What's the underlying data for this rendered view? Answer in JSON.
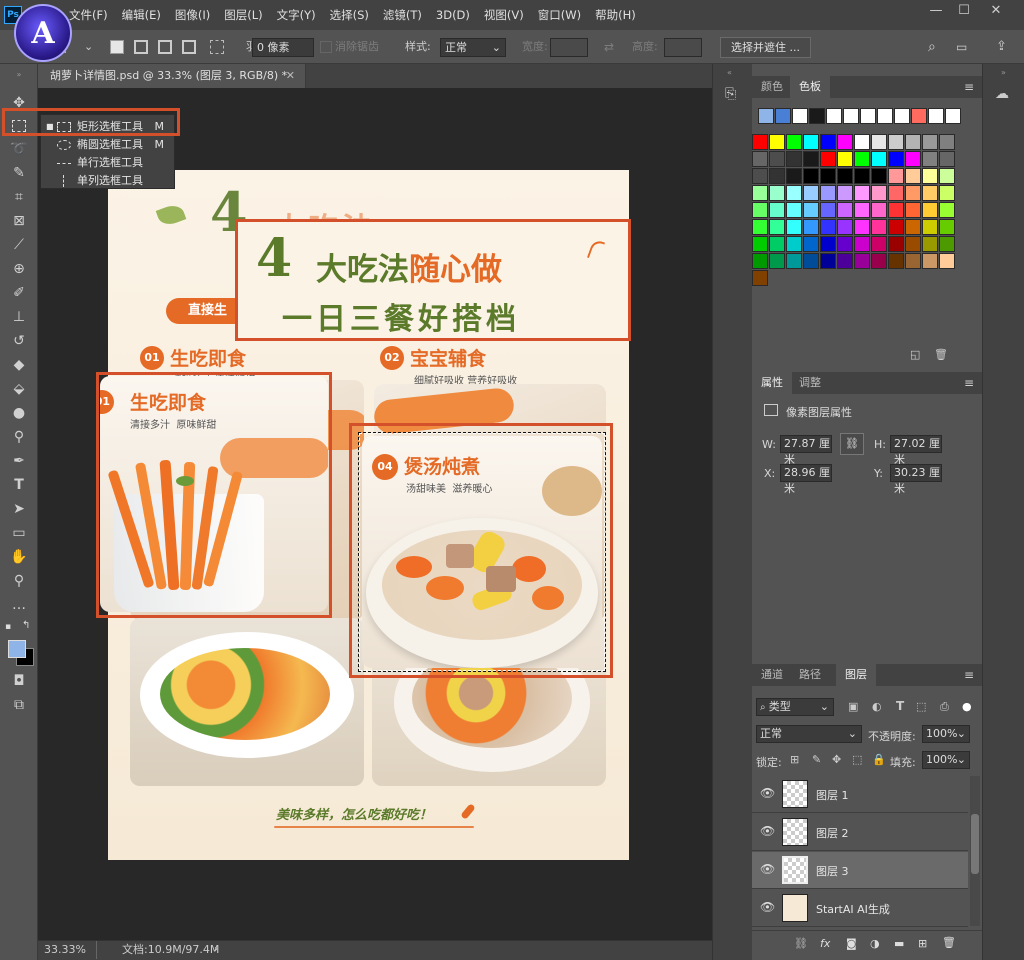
{
  "menubar": {
    "items": [
      "文件(F)",
      "编辑(E)",
      "图像(I)",
      "图层(L)",
      "文字(Y)",
      "选择(S)",
      "滤镜(T)",
      "3D(D)",
      "视图(V)",
      "窗口(W)",
      "帮助(H)"
    ],
    "app_logo_text": "Ps",
    "badge_letter": "A"
  },
  "options": {
    "feather_label": "羽化:",
    "feather_value": "0 像素",
    "antialias_label": "消除锯齿",
    "style_label": "样式:",
    "style_value": "正常",
    "width_label": "宽度:",
    "height_label": "高度:",
    "select_mask_button": "选择并遮住 ..."
  },
  "document": {
    "tab_title": "胡萝卜详情图.psd @ 33.3% (图层 3, RGB/8) *",
    "zoom": "33.33%",
    "doc_size": "文档:10.9M/97.4M"
  },
  "flyout": {
    "items": [
      {
        "label": "矩形选框工具",
        "key": "M"
      },
      {
        "label": "椭圆选框工具",
        "key": "M"
      },
      {
        "label": "单行选框工具",
        "key": ""
      },
      {
        "label": "单列选框工具",
        "key": ""
      }
    ]
  },
  "artboard": {
    "title_big_number": "4",
    "title_line1_a": "大吃法",
    "title_line1_b": "随心做",
    "title_line2": "一日三餐好搭档",
    "banner_label": "直接生",
    "sec01_num": "01",
    "sec01_title": "生吃即食",
    "sec01_sub": "清接多汁 原味鲜甜",
    "sec02_num": "02",
    "sec02_title": "宝宝辅食",
    "sec02_sub": "细腻好吸收 营养好吸收",
    "popout01_num": "01",
    "popout01_title": "生吃即食",
    "popout01_sub": "清接多汁  原味鲜甜",
    "sec04_num": "04",
    "sec04_title": "煲汤炖煮",
    "sec04_sub": "汤甜味美  滋养暖心",
    "footer_text": "美味多样，怎么吃都好吃！"
  },
  "swatches_panel": {
    "tabs": [
      "颜色",
      "色板"
    ],
    "active": "色板",
    "recent": [
      "#8fb4e8",
      "#4a7fd6",
      "#ffffff",
      "#1a1a1a",
      "#ffffff",
      "#ffffff",
      "#ffffff",
      "#ffffff",
      "#ffffff",
      "#ff6b5e",
      "#ffffff",
      "#ffffff"
    ],
    "grid": [
      [
        "#ff0000",
        "#ffff00",
        "#00ff00",
        "#00ffff",
        "#0000ff",
        "#ff00ff",
        "#ffffff",
        "#e6e6e6",
        "#cccccc",
        "#b3b3b3",
        "#999999",
        "#808080"
      ],
      [
        "#666666",
        "#4d4d4d",
        "#333333",
        "#1a1a1a",
        "#ff0000",
        "#ffff00",
        "#00ff00",
        "#00ffff",
        "#0000ff",
        "#ff00ff",
        "#808080",
        "#666666"
      ],
      [
        "#4d4d4d",
        "#333333",
        "#1a1a1a",
        "#000000",
        "#000000",
        "#000000",
        "#000000",
        "#000000",
        "#ff9999",
        "#ffcc99",
        "#ffff99",
        "#ccff99"
      ],
      [
        "#99ff99",
        "#99ffcc",
        "#99ffff",
        "#99ccff",
        "#9999ff",
        "#cc99ff",
        "#ff99ff",
        "#ff99cc",
        "#ff6666",
        "#ff9966",
        "#ffcc66",
        "#ccff66"
      ],
      [
        "#66ff66",
        "#66ffcc",
        "#66ffff",
        "#66ccff",
        "#6666ff",
        "#cc66ff",
        "#ff66ff",
        "#ff66cc",
        "#ff3333",
        "#ff6633",
        "#ffcc33",
        "#99ff33"
      ],
      [
        "#33ff33",
        "#33ff99",
        "#33ffff",
        "#3399ff",
        "#3333ff",
        "#9933ff",
        "#ff33ff",
        "#ff3399",
        "#cc0000",
        "#cc6600",
        "#cccc00",
        "#66cc00"
      ],
      [
        "#00cc00",
        "#00cc66",
        "#00cccc",
        "#0066cc",
        "#0000cc",
        "#6600cc",
        "#cc00cc",
        "#cc0066",
        "#990000",
        "#994c00",
        "#999900",
        "#4c9900"
      ],
      [
        "#009900",
        "#00994c",
        "#009999",
        "#004c99",
        "#000099",
        "#4c0099",
        "#990099",
        "#99004c",
        "#663300",
        "#996633",
        "#cc9966",
        "#ffcc99"
      ],
      [
        "#804000"
      ]
    ]
  },
  "properties_panel": {
    "tabs": [
      "属性",
      "调整"
    ],
    "active": "属性",
    "header": "像素图层属性",
    "w_label": "W:",
    "w_value": "27.87 厘米",
    "h_label": "H:",
    "h_value": "27.02 厘米",
    "x_label": "X:",
    "x_value": "28.96 厘米",
    "y_label": "Y:",
    "y_value": "30.23 厘米"
  },
  "layers_panel": {
    "tabs": [
      "通道",
      "路径",
      "图层"
    ],
    "active": "图层",
    "filter_kind": "类型",
    "blend_mode": "正常",
    "opacity_label": "不透明度:",
    "opacity_value": "100%",
    "lock_label": "锁定:",
    "fill_label": "填充:",
    "fill_value": "100%",
    "layers": [
      {
        "name": "图层 1",
        "selected": false
      },
      {
        "name": "图层 2",
        "selected": false
      },
      {
        "name": "图层 3",
        "selected": true
      },
      {
        "name": "StartAI AI生成",
        "selected": false
      }
    ]
  }
}
